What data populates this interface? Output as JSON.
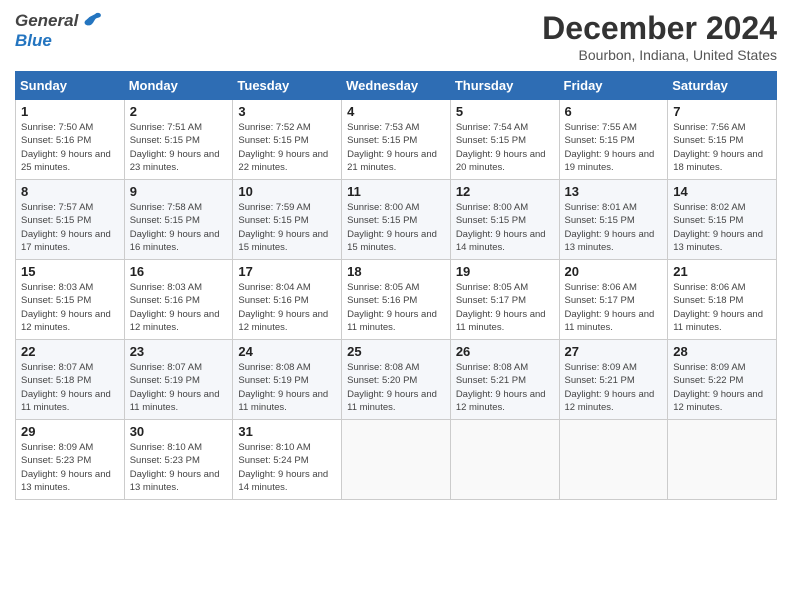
{
  "header": {
    "logo_general": "General",
    "logo_blue": "Blue",
    "month_title": "December 2024",
    "location": "Bourbon, Indiana, United States"
  },
  "weekdays": [
    "Sunday",
    "Monday",
    "Tuesday",
    "Wednesday",
    "Thursday",
    "Friday",
    "Saturday"
  ],
  "weeks": [
    [
      {
        "day": "1",
        "sunrise": "Sunrise: 7:50 AM",
        "sunset": "Sunset: 5:16 PM",
        "daylight": "Daylight: 9 hours and 25 minutes."
      },
      {
        "day": "2",
        "sunrise": "Sunrise: 7:51 AM",
        "sunset": "Sunset: 5:15 PM",
        "daylight": "Daylight: 9 hours and 23 minutes."
      },
      {
        "day": "3",
        "sunrise": "Sunrise: 7:52 AM",
        "sunset": "Sunset: 5:15 PM",
        "daylight": "Daylight: 9 hours and 22 minutes."
      },
      {
        "day": "4",
        "sunrise": "Sunrise: 7:53 AM",
        "sunset": "Sunset: 5:15 PM",
        "daylight": "Daylight: 9 hours and 21 minutes."
      },
      {
        "day": "5",
        "sunrise": "Sunrise: 7:54 AM",
        "sunset": "Sunset: 5:15 PM",
        "daylight": "Daylight: 9 hours and 20 minutes."
      },
      {
        "day": "6",
        "sunrise": "Sunrise: 7:55 AM",
        "sunset": "Sunset: 5:15 PM",
        "daylight": "Daylight: 9 hours and 19 minutes."
      },
      {
        "day": "7",
        "sunrise": "Sunrise: 7:56 AM",
        "sunset": "Sunset: 5:15 PM",
        "daylight": "Daylight: 9 hours and 18 minutes."
      }
    ],
    [
      {
        "day": "8",
        "sunrise": "Sunrise: 7:57 AM",
        "sunset": "Sunset: 5:15 PM",
        "daylight": "Daylight: 9 hours and 17 minutes."
      },
      {
        "day": "9",
        "sunrise": "Sunrise: 7:58 AM",
        "sunset": "Sunset: 5:15 PM",
        "daylight": "Daylight: 9 hours and 16 minutes."
      },
      {
        "day": "10",
        "sunrise": "Sunrise: 7:59 AM",
        "sunset": "Sunset: 5:15 PM",
        "daylight": "Daylight: 9 hours and 15 minutes."
      },
      {
        "day": "11",
        "sunrise": "Sunrise: 8:00 AM",
        "sunset": "Sunset: 5:15 PM",
        "daylight": "Daylight: 9 hours and 15 minutes."
      },
      {
        "day": "12",
        "sunrise": "Sunrise: 8:00 AM",
        "sunset": "Sunset: 5:15 PM",
        "daylight": "Daylight: 9 hours and 14 minutes."
      },
      {
        "day": "13",
        "sunrise": "Sunrise: 8:01 AM",
        "sunset": "Sunset: 5:15 PM",
        "daylight": "Daylight: 9 hours and 13 minutes."
      },
      {
        "day": "14",
        "sunrise": "Sunrise: 8:02 AM",
        "sunset": "Sunset: 5:15 PM",
        "daylight": "Daylight: 9 hours and 13 minutes."
      }
    ],
    [
      {
        "day": "15",
        "sunrise": "Sunrise: 8:03 AM",
        "sunset": "Sunset: 5:15 PM",
        "daylight": "Daylight: 9 hours and 12 minutes."
      },
      {
        "day": "16",
        "sunrise": "Sunrise: 8:03 AM",
        "sunset": "Sunset: 5:16 PM",
        "daylight": "Daylight: 9 hours and 12 minutes."
      },
      {
        "day": "17",
        "sunrise": "Sunrise: 8:04 AM",
        "sunset": "Sunset: 5:16 PM",
        "daylight": "Daylight: 9 hours and 12 minutes."
      },
      {
        "day": "18",
        "sunrise": "Sunrise: 8:05 AM",
        "sunset": "Sunset: 5:16 PM",
        "daylight": "Daylight: 9 hours and 11 minutes."
      },
      {
        "day": "19",
        "sunrise": "Sunrise: 8:05 AM",
        "sunset": "Sunset: 5:17 PM",
        "daylight": "Daylight: 9 hours and 11 minutes."
      },
      {
        "day": "20",
        "sunrise": "Sunrise: 8:06 AM",
        "sunset": "Sunset: 5:17 PM",
        "daylight": "Daylight: 9 hours and 11 minutes."
      },
      {
        "day": "21",
        "sunrise": "Sunrise: 8:06 AM",
        "sunset": "Sunset: 5:18 PM",
        "daylight": "Daylight: 9 hours and 11 minutes."
      }
    ],
    [
      {
        "day": "22",
        "sunrise": "Sunrise: 8:07 AM",
        "sunset": "Sunset: 5:18 PM",
        "daylight": "Daylight: 9 hours and 11 minutes."
      },
      {
        "day": "23",
        "sunrise": "Sunrise: 8:07 AM",
        "sunset": "Sunset: 5:19 PM",
        "daylight": "Daylight: 9 hours and 11 minutes."
      },
      {
        "day": "24",
        "sunrise": "Sunrise: 8:08 AM",
        "sunset": "Sunset: 5:19 PM",
        "daylight": "Daylight: 9 hours and 11 minutes."
      },
      {
        "day": "25",
        "sunrise": "Sunrise: 8:08 AM",
        "sunset": "Sunset: 5:20 PM",
        "daylight": "Daylight: 9 hours and 11 minutes."
      },
      {
        "day": "26",
        "sunrise": "Sunrise: 8:08 AM",
        "sunset": "Sunset: 5:21 PM",
        "daylight": "Daylight: 9 hours and 12 minutes."
      },
      {
        "day": "27",
        "sunrise": "Sunrise: 8:09 AM",
        "sunset": "Sunset: 5:21 PM",
        "daylight": "Daylight: 9 hours and 12 minutes."
      },
      {
        "day": "28",
        "sunrise": "Sunrise: 8:09 AM",
        "sunset": "Sunset: 5:22 PM",
        "daylight": "Daylight: 9 hours and 12 minutes."
      }
    ],
    [
      {
        "day": "29",
        "sunrise": "Sunrise: 8:09 AM",
        "sunset": "Sunset: 5:23 PM",
        "daylight": "Daylight: 9 hours and 13 minutes."
      },
      {
        "day": "30",
        "sunrise": "Sunrise: 8:10 AM",
        "sunset": "Sunset: 5:23 PM",
        "daylight": "Daylight: 9 hours and 13 minutes."
      },
      {
        "day": "31",
        "sunrise": "Sunrise: 8:10 AM",
        "sunset": "Sunset: 5:24 PM",
        "daylight": "Daylight: 9 hours and 14 minutes."
      },
      null,
      null,
      null,
      null
    ]
  ]
}
